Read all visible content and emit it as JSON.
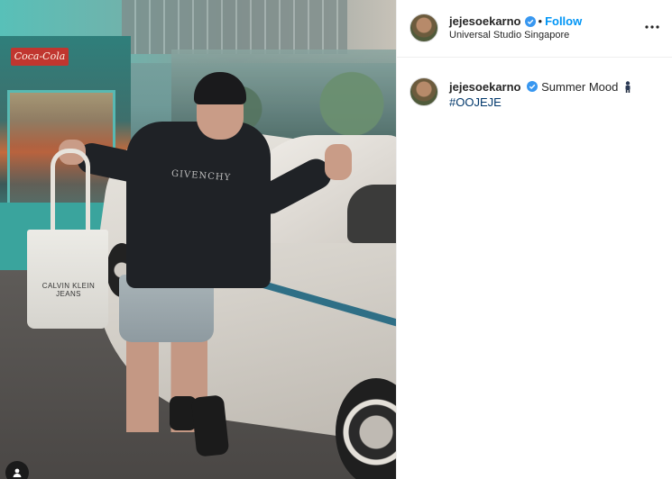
{
  "photo": {
    "store_sign": "Coca-Cola",
    "hoodie_print": "GIVENCHY",
    "bag_print": "CALVIN KLEIN JEANS"
  },
  "header": {
    "username": "jejesoekarno",
    "separator": "•",
    "follow_label": "Follow",
    "location": "Universal Studio Singapore",
    "more_icon": "more-options-icon",
    "verified_icon": "verified-badge-icon"
  },
  "caption": {
    "username": "jejesoekarno",
    "text": "Summer Mood",
    "emoji_icon": "man-emoji-icon",
    "hashtag": "#OOJEJE"
  },
  "colors": {
    "link_blue": "#0095f6",
    "hashtag_blue": "#00376b",
    "text": "#262626",
    "verified_blue": "#3897f0"
  }
}
